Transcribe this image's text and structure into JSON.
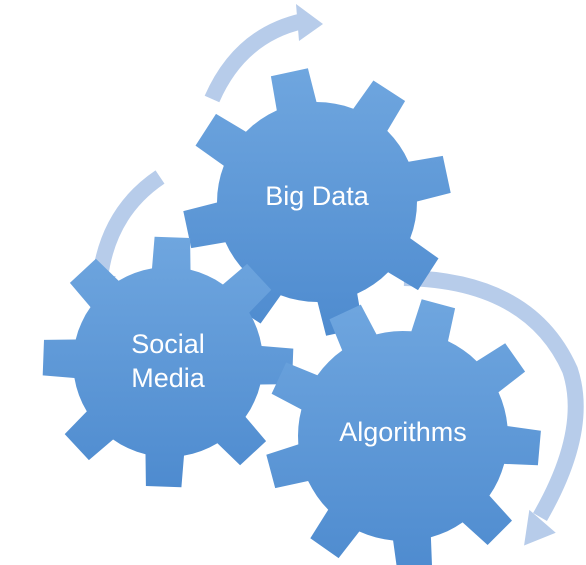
{
  "colors": {
    "gear_top": "#6FA6DF",
    "gear_bottom": "#4E8BCF",
    "arrow": "#B7CCEA",
    "label": "#FFFFFF"
  },
  "gears": [
    {
      "id": "big-data",
      "lines": [
        "Big Data"
      ]
    },
    {
      "id": "social-media",
      "lines": [
        "Social",
        "Media"
      ]
    },
    {
      "id": "algorithms",
      "lines": [
        "Algorithms"
      ]
    }
  ],
  "arrows": [
    {
      "id": "arrow-big-data-loop",
      "icon": "curved-arrow-icon"
    },
    {
      "id": "arrow-to-social-media",
      "icon": "curved-arrow-icon"
    },
    {
      "id": "arrow-algorithms-loop",
      "icon": "curved-arrow-icon"
    }
  ]
}
